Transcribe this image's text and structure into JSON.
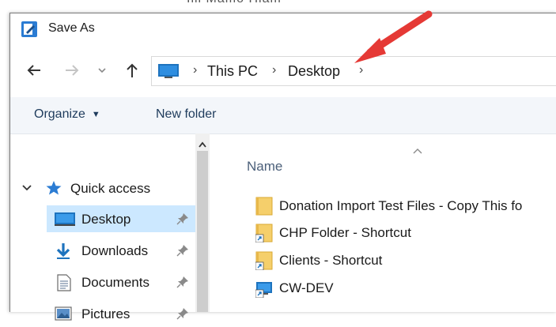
{
  "background_partial_text": "Illl Mamo Hlam",
  "window": {
    "title": "Save As",
    "icon": "save-as-app-icon"
  },
  "navigation": {
    "back_icon": "arrow-left-icon",
    "forward_icon": "arrow-right-icon",
    "recent_icon": "chevron-down-icon",
    "up_icon": "arrow-up-icon"
  },
  "address_bar": {
    "location_icon": "this-pc-icon",
    "breadcrumbs": [
      "This PC",
      "Desktop"
    ],
    "separator": "›"
  },
  "toolbar": {
    "organize_label": "Organize",
    "organize_caret": "▼",
    "new_folder_label": "New folder"
  },
  "nav_pane": {
    "quick_access_label": "Quick access",
    "items": [
      {
        "label": "Desktop",
        "icon": "desktop-icon",
        "pinned": true,
        "selected": true
      },
      {
        "label": "Downloads",
        "icon": "download-icon",
        "pinned": true,
        "selected": false
      },
      {
        "label": "Documents",
        "icon": "documents-icon",
        "pinned": true,
        "selected": false
      },
      {
        "label": "Pictures",
        "icon": "pictures-icon",
        "pinned": true,
        "selected": false
      }
    ]
  },
  "file_list": {
    "column_name": "Name",
    "items": [
      {
        "label": "Donation Import Test Files - Copy This fo",
        "icon": "folder-icon"
      },
      {
        "label": "CHP Folder - Shortcut",
        "icon": "folder-shortcut-icon"
      },
      {
        "label": "Clients - Shortcut",
        "icon": "folder-shortcut-icon"
      },
      {
        "label": "CW-DEV",
        "icon": "computer-shortcut-icon"
      }
    ]
  },
  "colors": {
    "annotation_arrow": "#e53935",
    "selection": "#cce8ff",
    "toolbar_bg": "#f3f6fa",
    "accent_blue": "#1e73be"
  }
}
